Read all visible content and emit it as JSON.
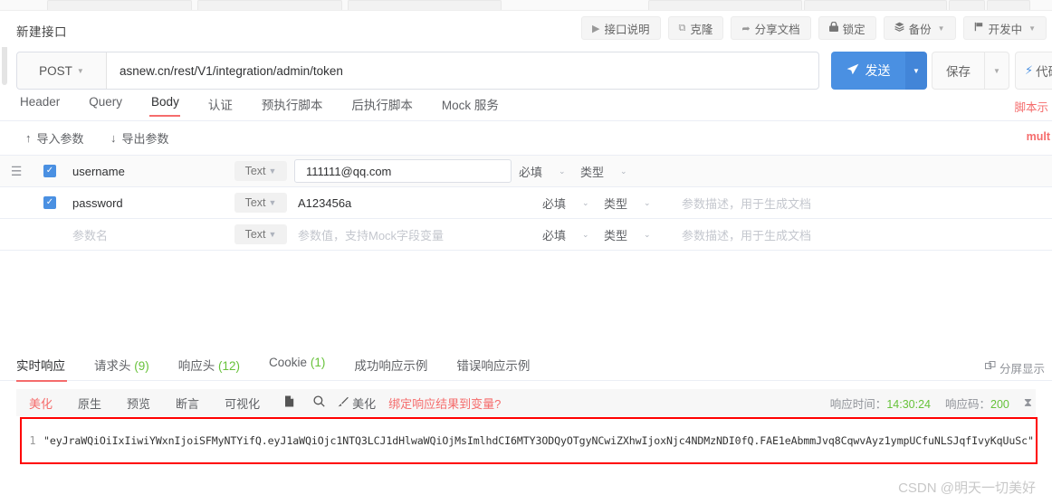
{
  "header": {
    "api_title": "新建接口",
    "tools": [
      {
        "label": "接口说明",
        "icon": "play-icon",
        "glyph": "▶",
        "caret": false
      },
      {
        "label": "克隆",
        "icon": "copy-icon",
        "glyph": "⧉",
        "caret": false
      },
      {
        "label": "分享文档",
        "icon": "share-icon",
        "glyph": "➦",
        "caret": false
      },
      {
        "label": "锁定",
        "icon": "lock-icon",
        "glyph": "🔒",
        "caret": false
      },
      {
        "label": "备份",
        "icon": "layers-icon",
        "glyph": "☰",
        "caret": true
      },
      {
        "label": "开发中",
        "icon": "flag-icon",
        "glyph": "⚑",
        "caret": true
      }
    ]
  },
  "url_row": {
    "method": "POST",
    "url": "asnew.cn/rest/V1/integration/admin/token",
    "send_label": "发送",
    "send_icon": "paper-plane-icon",
    "save_label": "保存",
    "code_label": "代码",
    "code_icon": "lightning-bolt-icon"
  },
  "request_tabs": {
    "items": [
      {
        "label": "Header",
        "active": false
      },
      {
        "label": "Query",
        "active": false
      },
      {
        "label": "Body",
        "active": true
      },
      {
        "label": "认证",
        "active": false
      },
      {
        "label": "预执行脚本",
        "active": false
      },
      {
        "label": "后执行脚本",
        "active": false
      },
      {
        "label": "Mock 服务",
        "active": false
      }
    ],
    "script_link": "脚本示"
  },
  "params_toolbar": {
    "import_label": "导入参数",
    "export_label": "导出参数",
    "body_type": "mult"
  },
  "params_table": {
    "required_label": "必填",
    "type_label": "类型",
    "text_type": "Text",
    "desc_placeholder": "参数描述，用于生成文档",
    "name_placeholder": "参数名",
    "value_placeholder": "参数值，支持Mock字段变量",
    "rows": [
      {
        "checked": true,
        "handle": true,
        "name": "username",
        "type": "Text",
        "value": "111111@qq.com",
        "value_boxed": true,
        "required": "必填",
        "kind": "类型",
        "desc": "",
        "placeholder": false
      },
      {
        "checked": true,
        "handle": false,
        "name": "password",
        "type": "Text",
        "value": "A123456a",
        "value_boxed": false,
        "required": "必填",
        "kind": "类型",
        "desc": "参数描述，用于生成文档",
        "placeholder": false
      },
      {
        "checked": false,
        "handle": false,
        "name": "参数名",
        "type": "Text",
        "value": "参数值，支持Mock字段变量",
        "value_boxed": false,
        "required": "必填",
        "kind": "类型",
        "desc": "参数描述，用于生成文档",
        "placeholder": true
      }
    ]
  },
  "response_tabs": {
    "items": [
      {
        "label": "实时响应",
        "count": "",
        "active": true
      },
      {
        "label": "请求头",
        "count": "(9)",
        "active": false
      },
      {
        "label": "响应头",
        "count": "(12)",
        "active": false
      },
      {
        "label": "Cookie",
        "count": "(1)",
        "active": false
      },
      {
        "label": "成功响应示例",
        "count": "",
        "active": false
      },
      {
        "label": "错误响应示例",
        "count": "",
        "active": false
      }
    ],
    "split_label": "分屏显示",
    "split_icon": "split-screen-icon"
  },
  "viewer_toolbar": {
    "tabs": [
      {
        "label": "美化",
        "active": true
      },
      {
        "label": "原生",
        "active": false
      },
      {
        "label": "预览",
        "active": false
      },
      {
        "label": "断言",
        "active": false
      },
      {
        "label": "可视化",
        "active": false
      }
    ],
    "copy_icon": "copy-icon",
    "search_icon": "search-icon",
    "beautify_label": "美化",
    "beautify_icon": "brush-icon",
    "bind_link": "绑定响应结果到变量?",
    "time_label": "响应时间：",
    "time_value": "14:30:24",
    "code_label": "响应码：",
    "code_value": "200",
    "hourglass_icon": "hourglass-icon"
  },
  "response_body": {
    "line_number": "1",
    "content": "\"eyJraWQiOiIxIiwiYWxnIjoiSFMyNTYifQ.eyJ1aWQiOjc1NTQ3LCJ1dHlwaWQiOjMsImlhdCI6MTY3ODQyOTgyNCwiZXhwIjoxNjc4NDMzNDI0fQ.FAE1eAbmmJvq8CqwvAyz1ympUCfuNLSJqfIvyKqUuSc\""
  },
  "watermark": "CSDN @明天一切美好"
}
